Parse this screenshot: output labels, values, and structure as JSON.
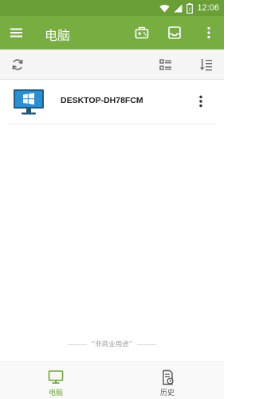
{
  "status_bar": {
    "time": "12:06",
    "icons": [
      "wifi-icon",
      "signal-icon",
      "battery-icon"
    ]
  },
  "app_bar": {
    "title": "电脑",
    "icons": [
      "menu-icon",
      "game-controller-icon",
      "inbox-icon",
      "more-vert-icon"
    ],
    "background": "#78ad42"
  },
  "toolbar": {
    "icons": [
      "refresh-icon",
      "list-view-icon",
      "sort-icon"
    ]
  },
  "devices": [
    {
      "name": "DESKTOP-DH78FCM",
      "icon": "windows-monitor-icon"
    }
  ],
  "footnote": "“非商业用途”",
  "bottom_nav": {
    "items": [
      {
        "label": "电脑",
        "icon": "monitor-icon",
        "active": true
      },
      {
        "label": "历史",
        "icon": "history-document-icon",
        "active": false
      }
    ],
    "active_color": "#6ea53a"
  }
}
